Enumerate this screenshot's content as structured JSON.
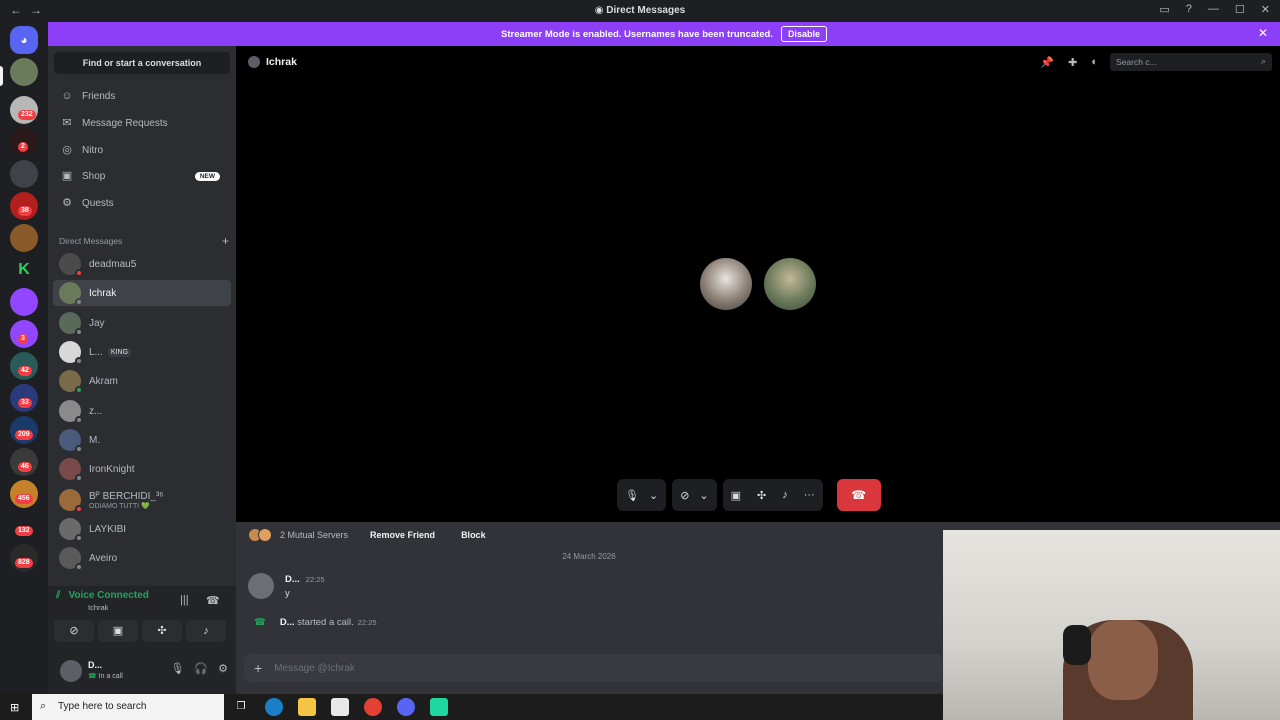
{
  "window": {
    "title": "Direct Messages"
  },
  "banner": {
    "text": "Streamer Mode is enabled. Usernames have been truncated.",
    "disable_label": "Disable"
  },
  "rail": {
    "badges": [
      "232",
      "2",
      "38",
      "3",
      "42",
      "33",
      "209",
      "46",
      "456",
      "132",
      "828"
    ]
  },
  "sidebar": {
    "find_label": "Find or start a conversation",
    "nav": [
      {
        "label": "Friends",
        "icon": "friends-icon"
      },
      {
        "label": "Message Requests",
        "icon": "mail-icon"
      },
      {
        "label": "Nitro",
        "icon": "nitro-icon"
      },
      {
        "label": "Shop",
        "icon": "shop-icon",
        "tag": "NEW"
      },
      {
        "label": "Quests",
        "icon": "quests-icon"
      }
    ],
    "dm_header": "Direct Messages",
    "dms": [
      {
        "name": "deadmau5"
      },
      {
        "name": "Ichrak"
      },
      {
        "name": "Jay"
      },
      {
        "name": "L...",
        "tag": "KING"
      },
      {
        "name": "Akram"
      },
      {
        "name": "z..."
      },
      {
        "name": "M."
      },
      {
        "name": "IronKnight"
      },
      {
        "name": "Bᴾ BERCHIDI_³⁶",
        "sub": "ODIAMO TUTTI 💚"
      },
      {
        "name": "LAYKIBI"
      },
      {
        "name": "Aveiro"
      }
    ]
  },
  "voice": {
    "status": "Voice Connected",
    "channel": "Ichrak",
    "user_name": "D...",
    "user_status": "In a call"
  },
  "main": {
    "channel_name": "Ichrak",
    "search_placeholder": "Search c...",
    "mutual_servers": "2 Mutual Servers",
    "remove_friend": "Remove Friend",
    "block": "Block",
    "date": "24 March 2026",
    "message": {
      "author": "D...",
      "time": "22:25",
      "text": "y"
    },
    "system": {
      "author": "D...",
      "text": "started a call.",
      "time": "22:25"
    },
    "composer_placeholder": "Message @Ichrak"
  },
  "taskbar": {
    "search_placeholder": "Type here to search"
  },
  "colors": {
    "accent": "#5865f2",
    "banner": "#8c3ff7",
    "online": "#23a55a",
    "dnd": "#f23f43",
    "hangup": "#da373c"
  }
}
